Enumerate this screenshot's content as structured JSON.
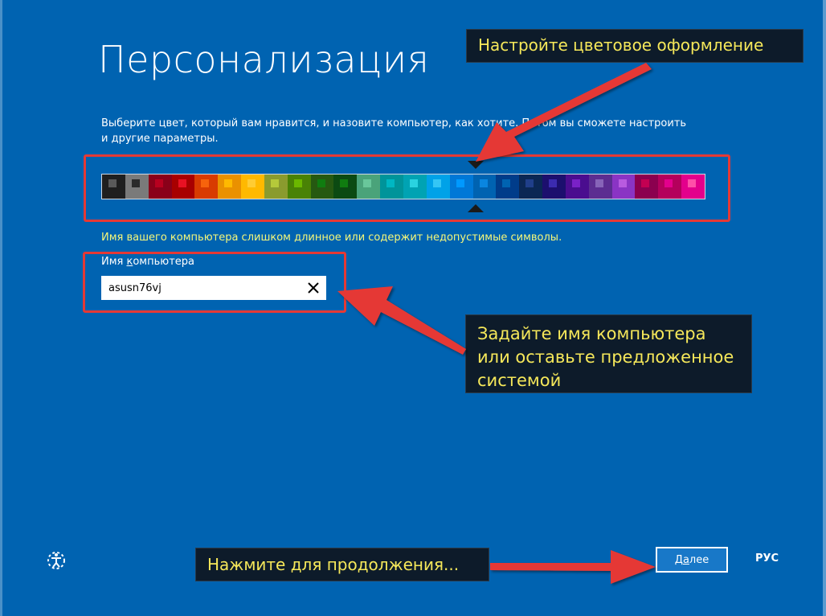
{
  "page": {
    "title": "Персонализация",
    "description": "Выберите цвет, который вам нравится, и назовите компьютер, как хотите. Потом вы сможете настроить и другие параметры."
  },
  "colors": {
    "background": "#0063b1",
    "highlight": "#e53935",
    "warning_text": "#f5f77a",
    "callout_text": "#f6e85a",
    "callout_bg": "#0d1b2a"
  },
  "palette": {
    "selected_index": 15,
    "swatches": [
      {
        "bg": "#1f1f1f",
        "chip": "#5a5a5a"
      },
      {
        "bg": "#7a7a7a",
        "chip": "#2a2a2a"
      },
      {
        "bg": "#8a0019",
        "chip": "#b8001f"
      },
      {
        "bg": "#a80000",
        "chip": "#e81123"
      },
      {
        "bg": "#d83b01",
        "chip": "#f7630c"
      },
      {
        "bg": "#ea9100",
        "chip": "#ffb900"
      },
      {
        "bg": "#ffb900",
        "chip": "#ffcc33"
      },
      {
        "bg": "#8a9b2e",
        "chip": "#b5c93a"
      },
      {
        "bg": "#498205",
        "chip": "#6bb700"
      },
      {
        "bg": "#265911",
        "chip": "#107c10"
      },
      {
        "bg": "#0b4a12",
        "chip": "#107c10"
      },
      {
        "bg": "#4aa37a",
        "chip": "#69c79b"
      },
      {
        "bg": "#00949a",
        "chip": "#00b7c3"
      },
      {
        "bg": "#00a3b3",
        "chip": "#2ad3e0"
      },
      {
        "bg": "#00a2e8",
        "chip": "#35c6f5"
      },
      {
        "bg": "#0078d7",
        "chip": "#0099ff"
      },
      {
        "bg": "#0063b1",
        "chip": "#0a86e0"
      },
      {
        "bg": "#003c8a",
        "chip": "#0063b1"
      },
      {
        "bg": "#0b2754",
        "chip": "#203f8a"
      },
      {
        "bg": "#1c0f6e",
        "chip": "#3b2bb0"
      },
      {
        "bg": "#4a0d8f",
        "chip": "#7a21c7"
      },
      {
        "bg": "#5c2d91",
        "chip": "#8764b8"
      },
      {
        "bg": "#8a34c4",
        "chip": "#b85be0"
      },
      {
        "bg": "#8b004f",
        "chip": "#c30052"
      },
      {
        "bg": "#b4005c",
        "chip": "#e3008c"
      },
      {
        "bg": "#e3008c",
        "chip": "#ff4fa8"
      }
    ]
  },
  "form": {
    "warning": "Имя вашего компьютера слишком длинное или содержит недопустимые символы.",
    "name_label_prefix": "Имя ",
    "name_label_access": "к",
    "name_label_rest": "омпьютера",
    "name_value": "asusn76vj",
    "clear_symbol": "✕"
  },
  "callouts": {
    "color": "Настройте цветовое оформление",
    "name_line1": "Задайте имя компьютера",
    "name_line2": "или оставьте предложенное",
    "name_line3": "системой",
    "next": "Нажмите для продолжения..."
  },
  "footer": {
    "next_prefix": "Д",
    "next_access": "а",
    "next_rest": "лее",
    "language": "РУС",
    "accessibility_icon": "ease-of-access-icon"
  }
}
